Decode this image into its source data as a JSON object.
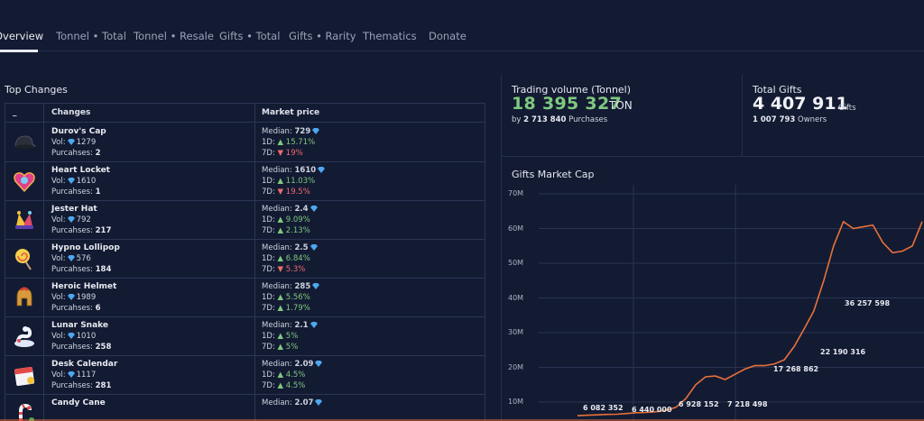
{
  "tabs": [
    "Overview",
    "Tonnel • Total",
    "Tonnel • Resale",
    "Gifts • Total",
    "Gifts • Rarity",
    "Thematics",
    "Donate"
  ],
  "top_changes": {
    "title": "Top Changes",
    "columns": [
      "_",
      "Changes",
      "Market price"
    ],
    "vol_label": "Vol:",
    "purchases_label": "Purcahses:",
    "median_label": "Median:",
    "d1_label": "1D:",
    "d7_label": "7D:",
    "rows": [
      {
        "name": "Durov's Cap",
        "icon": "cap-icon",
        "vol": "1279",
        "purchases": "2",
        "median": "729",
        "d1": "15.71%",
        "d1_dir": "up",
        "d7": "19%",
        "d7_dir": "down"
      },
      {
        "name": "Heart Locket",
        "icon": "locket-icon",
        "vol": "1610",
        "purchases": "1",
        "median": "1610",
        "d1": "11.03%",
        "d1_dir": "up",
        "d7": "19.5%",
        "d7_dir": "down"
      },
      {
        "name": "Jester Hat",
        "icon": "jester-hat-icon",
        "vol": "792",
        "purchases": "217",
        "median": "2.4",
        "d1": "9.09%",
        "d1_dir": "up",
        "d7": "2.13%",
        "d7_dir": "up"
      },
      {
        "name": "Hypno Lollipop",
        "icon": "lollipop-icon",
        "vol": "576",
        "purchases": "184",
        "median": "2.5",
        "d1": "6.84%",
        "d1_dir": "up",
        "d7": "5.3%",
        "d7_dir": "down"
      },
      {
        "name": "Heroic Helmet",
        "icon": "helmet-icon",
        "vol": "1989",
        "purchases": "6",
        "median": "285",
        "d1": "5.56%",
        "d1_dir": "up",
        "d7": "1.79%",
        "d7_dir": "up"
      },
      {
        "name": "Lunar Snake",
        "icon": "snake-icon",
        "vol": "1010",
        "purchases": "258",
        "median": "2.1",
        "d1": "5%",
        "d1_dir": "up",
        "d7": "5%",
        "d7_dir": "up"
      },
      {
        "name": "Desk Calendar",
        "icon": "calendar-icon",
        "vol": "1117",
        "purchases": "281",
        "median": "2.09",
        "d1": "4.5%",
        "d1_dir": "up",
        "d7": "4.5%",
        "d7_dir": "up"
      },
      {
        "name": "Candy Cane",
        "icon": "candy-cane-icon",
        "vol": "",
        "purchases": "",
        "median": "2.07",
        "d1": "",
        "d1_dir": "up",
        "d7": "",
        "d7_dir": "up"
      }
    ]
  },
  "trading_volume": {
    "title": "Trading volume (Tonnel)",
    "value": "18 395 327",
    "unit": "TON",
    "by_prefix": "by",
    "purchases_value": "2 713 840",
    "purchases_label": "Purchases"
  },
  "total_gifts": {
    "title": "Total Gifts",
    "value": "4 407 911",
    "unit": "Gifts",
    "owners_value": "1 007 793",
    "owners_label": "Owners"
  },
  "market_cap": {
    "title": "Gifts Market Cap"
  },
  "chart_data": {
    "type": "line",
    "title": "Gifts Market Cap",
    "xlabel": "",
    "ylabel": "",
    "y_ticks": [
      "70M",
      "60M",
      "50M",
      "40M",
      "30M",
      "20M",
      "10M"
    ],
    "ylim": [
      8500000,
      72000000
    ],
    "grid": true,
    "series_color": "#e8713a",
    "x": [
      0,
      1,
      2,
      3,
      4,
      5,
      6,
      7,
      8,
      9,
      10,
      11,
      12,
      13,
      14,
      15,
      16,
      17,
      18,
      19,
      20,
      21,
      22,
      23,
      24,
      25,
      26,
      27,
      28,
      29,
      30,
      31,
      32,
      33,
      34,
      35
    ],
    "values": [
      6082352,
      6200000,
      6300000,
      6440000,
      6500000,
      6700000,
      6928152,
      7000000,
      7218498,
      7600000,
      8500000,
      11000000,
      15000000,
      17268862,
      17500000,
      16500000,
      18000000,
      19500000,
      20500000,
      20500000,
      21000000,
      22190316,
      26000000,
      31000000,
      36257598,
      45000000,
      55000000,
      62000000,
      60000000,
      60500000,
      61000000,
      56000000,
      53000000,
      53500000,
      55000000,
      62000000
    ],
    "annotations": [
      "6 082 352",
      "6 440 000",
      "6 928 152",
      "7 218 498",
      "17 268 862",
      "22 190 316",
      "36 257 598"
    ]
  }
}
